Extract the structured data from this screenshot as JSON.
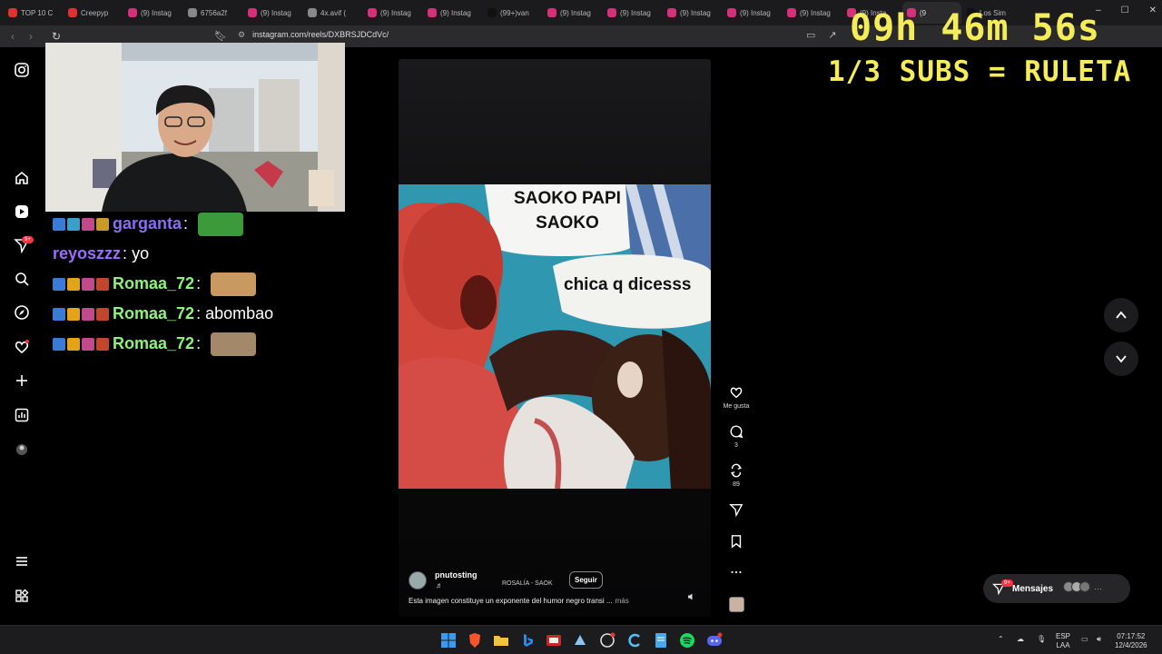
{
  "browser": {
    "tabs": [
      {
        "title": "TOP 10 C",
        "color": "#e03030"
      },
      {
        "title": "Creepyp",
        "color": "#e03030"
      },
      {
        "title": "(9) Instag",
        "color": "#d6307a"
      },
      {
        "title": "6756a2f",
        "color": "#888888"
      },
      {
        "title": "(9) Instag",
        "color": "#d6307a"
      },
      {
        "title": "4x.avif (",
        "color": "#888888"
      },
      {
        "title": "(9) Instag",
        "color": "#d6307a"
      },
      {
        "title": "(9) Instag",
        "color": "#d6307a"
      },
      {
        "title": "(99+)van",
        "color": "#111111"
      },
      {
        "title": "(9) Instag",
        "color": "#d6307a"
      },
      {
        "title": "(9) Instag",
        "color": "#d6307a"
      },
      {
        "title": "(9) Instag",
        "color": "#d6307a"
      },
      {
        "title": "(9) Instag",
        "color": "#d6307a"
      },
      {
        "title": "(9) Instag",
        "color": "#d6307a"
      },
      {
        "title": "(9) Insta",
        "color": "#d6307a"
      },
      {
        "title": "(9",
        "color": "#d6307a",
        "active": true
      },
      {
        "title": "Los Sim",
        "color": "#111111"
      }
    ],
    "url": "instagram.com/reels/DXBRSJDCdVc/"
  },
  "sidebar": {
    "notifications_badge": "9+",
    "items": [
      "instagram-logo-icon",
      "home-icon",
      "reels-icon",
      "messages-icon",
      "search-icon",
      "explore-icon",
      "notifications-icon",
      "create-icon",
      "dashboard-icon",
      "profile-icon",
      "more-menu-icon",
      "also-from-meta-icon"
    ]
  },
  "stream": {
    "timer": "09h 46m 56s",
    "subs_text": "1/3 SUBS = RULETA",
    "accent_color": "#f5ec5a"
  },
  "chat": [
    {
      "user": "garganta",
      "user_color": "#8a6df0",
      "text": "",
      "emote": true,
      "emote_color": "#3c9a3a",
      "badges": [
        "#3a7bd5",
        "#3aa0c8",
        "#c04a8a",
        "#c79a2a"
      ]
    },
    {
      "user": "reyoszzz",
      "user_color": "#9b6dff",
      "text": "yo",
      "emote": false,
      "badges": []
    },
    {
      "user": "Romaa_72",
      "user_color": "#8ef27a",
      "text": "",
      "emote": true,
      "emote_color": "#c89a62",
      "badges": [
        "#3a7bd5",
        "#e3a41a",
        "#c04a8a",
        "#c2452d"
      ]
    },
    {
      "user": "Romaa_72",
      "user_color": "#8ef27a",
      "text": "abombao",
      "emote": false,
      "badges": [
        "#3a7bd5",
        "#e3a41a",
        "#c04a8a",
        "#c2452d"
      ]
    },
    {
      "user": "Romaa_72",
      "user_color": "#8ef27a",
      "text": "",
      "emote": true,
      "emote_color": "#a4886a",
      "badges": [
        "#3a7bd5",
        "#e3a41a",
        "#c04a8a",
        "#c2452d"
      ]
    }
  ],
  "reel": {
    "meme_text_top": "SAOKO PAPI\nSAOKO",
    "meme_text_right": "chica q dicesss",
    "author": "pnutosting",
    "song": "ROSALÍA - SAOK",
    "follow_label": "Seguir",
    "caption": "Esta imagen constituye un exponente del humor negro transi ...",
    "more_label": "más",
    "actions": {
      "like_label": "Me gusta",
      "comments": "3",
      "reposts": "89"
    }
  },
  "messages": {
    "label": "Mensajes",
    "badge": "9+"
  },
  "taskbar": {
    "lang_top": "ESP",
    "lang_bottom": "LAA",
    "time": "07:17:52",
    "date": "12/4/2026"
  }
}
